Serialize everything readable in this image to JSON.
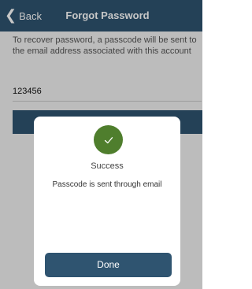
{
  "nav": {
    "back_label": "Back",
    "title": "Forgot Password"
  },
  "form": {
    "instructions": "To recover password, a passcode will be sent to the email address associated with this account",
    "passcode_value": "123456"
  },
  "dialog": {
    "status_icon": "checkmark-icon",
    "title": "Success",
    "message": "Passcode is sent through email",
    "done_label": "Done"
  },
  "colors": {
    "primary": "#2f5470",
    "success": "#4f7e2d",
    "background": "#f1f1f1"
  }
}
